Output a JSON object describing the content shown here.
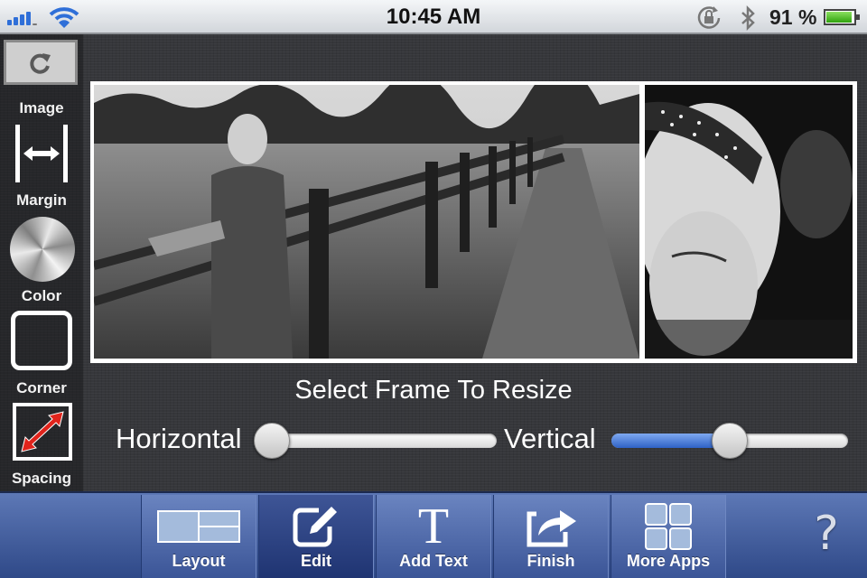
{
  "status_bar": {
    "time": "10:45 AM",
    "battery_percent_label": "91 %",
    "battery_level": 0.91,
    "icons": [
      "signal-bars-icon",
      "wifi-icon",
      "rotation-lock-icon",
      "bluetooth-icon",
      "battery-icon"
    ]
  },
  "sidebar": {
    "refresh_icon": "refresh-icon",
    "items": [
      {
        "label": "Image",
        "icon": "margin-icon"
      },
      {
        "label": "Margin",
        "icon": "color-wheel-icon"
      },
      {
        "label": "Color",
        "icon": "corner-icon"
      },
      {
        "label": "Corner",
        "icon": "spacing-icon"
      },
      {
        "label": "Spacing",
        "icon": ""
      }
    ]
  },
  "canvas": {
    "frames": [
      {
        "description": "black-and-white photo of woman leaning on wooden fence in a field"
      },
      {
        "description": "black-and-white close-up portrait of woman with polka-dot headband"
      }
    ]
  },
  "controls": {
    "hint": "Select Frame To Resize",
    "horizontal": {
      "label": "Horizontal",
      "value": 0.05
    },
    "vertical": {
      "label": "Vertical",
      "value": 0.5
    }
  },
  "toolbar": {
    "buttons": [
      {
        "label": "Layout",
        "icon": "layout-icon",
        "active": false
      },
      {
        "label": "Edit",
        "icon": "edit-icon",
        "active": true
      },
      {
        "label": "Add Text",
        "icon": "text-icon",
        "active": false
      },
      {
        "label": "Finish",
        "icon": "share-icon",
        "active": false
      },
      {
        "label": "More Apps",
        "icon": "grid-icon",
        "active": false
      }
    ],
    "help_icon": "help-icon",
    "text_glyph": "T",
    "help_glyph": "?"
  },
  "colors": {
    "accent_blue": "#2f62c6",
    "toolbar_blue": "#3b5597",
    "spacing_arrow_red": "#e0241c",
    "battery_green": "#2ea20c"
  }
}
